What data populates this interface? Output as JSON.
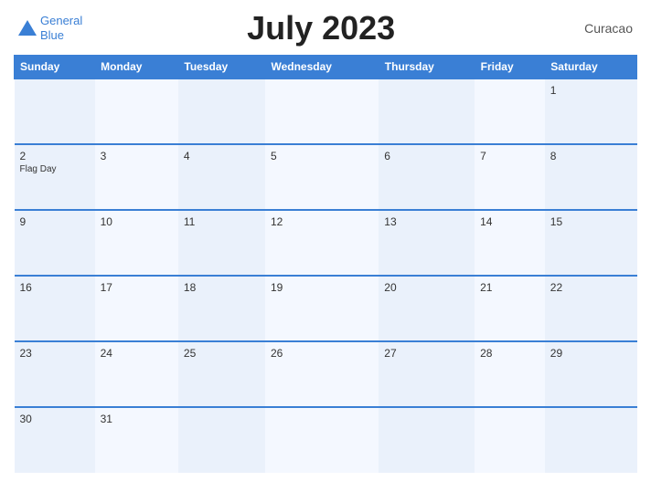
{
  "header": {
    "title": "July 2023",
    "country": "Curacao",
    "logo": {
      "line1": "General",
      "line2": "Blue"
    }
  },
  "weekdays": [
    "Sunday",
    "Monday",
    "Tuesday",
    "Wednesday",
    "Thursday",
    "Friday",
    "Saturday"
  ],
  "weeks": [
    [
      {
        "date": "",
        "event": ""
      },
      {
        "date": "",
        "event": ""
      },
      {
        "date": "",
        "event": ""
      },
      {
        "date": "",
        "event": ""
      },
      {
        "date": "",
        "event": ""
      },
      {
        "date": "",
        "event": ""
      },
      {
        "date": "1",
        "event": ""
      }
    ],
    [
      {
        "date": "2",
        "event": "Flag Day"
      },
      {
        "date": "3",
        "event": ""
      },
      {
        "date": "4",
        "event": ""
      },
      {
        "date": "5",
        "event": ""
      },
      {
        "date": "6",
        "event": ""
      },
      {
        "date": "7",
        "event": ""
      },
      {
        "date": "8",
        "event": ""
      }
    ],
    [
      {
        "date": "9",
        "event": ""
      },
      {
        "date": "10",
        "event": ""
      },
      {
        "date": "11",
        "event": ""
      },
      {
        "date": "12",
        "event": ""
      },
      {
        "date": "13",
        "event": ""
      },
      {
        "date": "14",
        "event": ""
      },
      {
        "date": "15",
        "event": ""
      }
    ],
    [
      {
        "date": "16",
        "event": ""
      },
      {
        "date": "17",
        "event": ""
      },
      {
        "date": "18",
        "event": ""
      },
      {
        "date": "19",
        "event": ""
      },
      {
        "date": "20",
        "event": ""
      },
      {
        "date": "21",
        "event": ""
      },
      {
        "date": "22",
        "event": ""
      }
    ],
    [
      {
        "date": "23",
        "event": ""
      },
      {
        "date": "24",
        "event": ""
      },
      {
        "date": "25",
        "event": ""
      },
      {
        "date": "26",
        "event": ""
      },
      {
        "date": "27",
        "event": ""
      },
      {
        "date": "28",
        "event": ""
      },
      {
        "date": "29",
        "event": ""
      }
    ],
    [
      {
        "date": "30",
        "event": ""
      },
      {
        "date": "31",
        "event": ""
      },
      {
        "date": "",
        "event": ""
      },
      {
        "date": "",
        "event": ""
      },
      {
        "date": "",
        "event": ""
      },
      {
        "date": "",
        "event": ""
      },
      {
        "date": "",
        "event": ""
      }
    ]
  ]
}
